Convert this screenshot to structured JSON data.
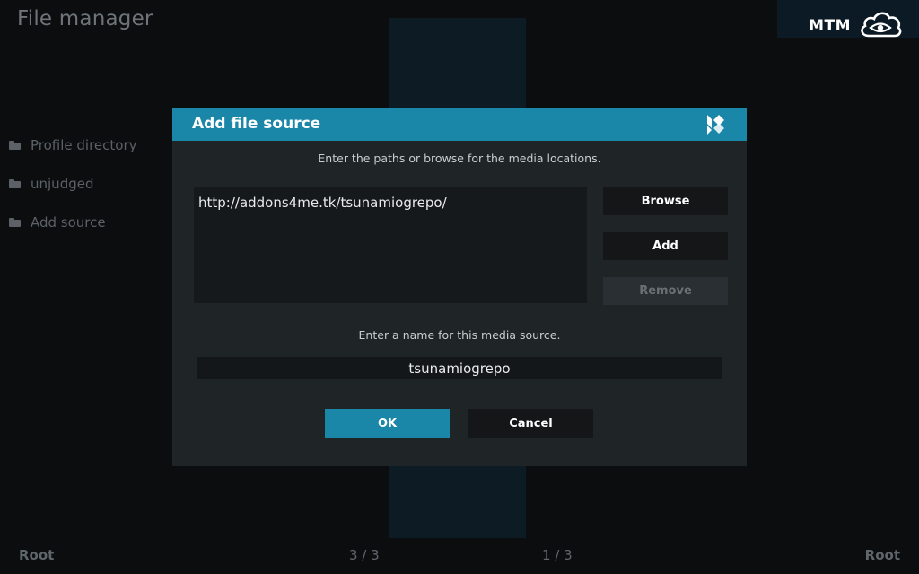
{
  "window": {
    "title": "File manager"
  },
  "brand": {
    "text": "MTM",
    "icon": "eye-cloud-icon"
  },
  "sidebar": {
    "items": [
      {
        "label": "Profile directory",
        "icon": "folder-icon"
      },
      {
        "label": "unjudged",
        "icon": "folder-icon"
      },
      {
        "label": "Add source",
        "icon": "folder-icon"
      }
    ]
  },
  "footer": {
    "left_label": "Root",
    "right_label": "Root",
    "left_pages": "3 / 3",
    "right_pages": "1 / 3"
  },
  "dialog": {
    "title": "Add file source",
    "logo_icon": "kodi-logo-icon",
    "paths_instruction": "Enter the paths or browse for the media locations.",
    "paths": [
      "http://addons4me.tk/tsunamiogrepo/"
    ],
    "browse_label": "Browse",
    "add_label": "Add",
    "remove_label": "Remove",
    "name_instruction": "Enter a name for this media source.",
    "name_value": "tsunamiogrepo",
    "ok_label": "OK",
    "cancel_label": "Cancel",
    "accent_color": "#1a87a8"
  }
}
